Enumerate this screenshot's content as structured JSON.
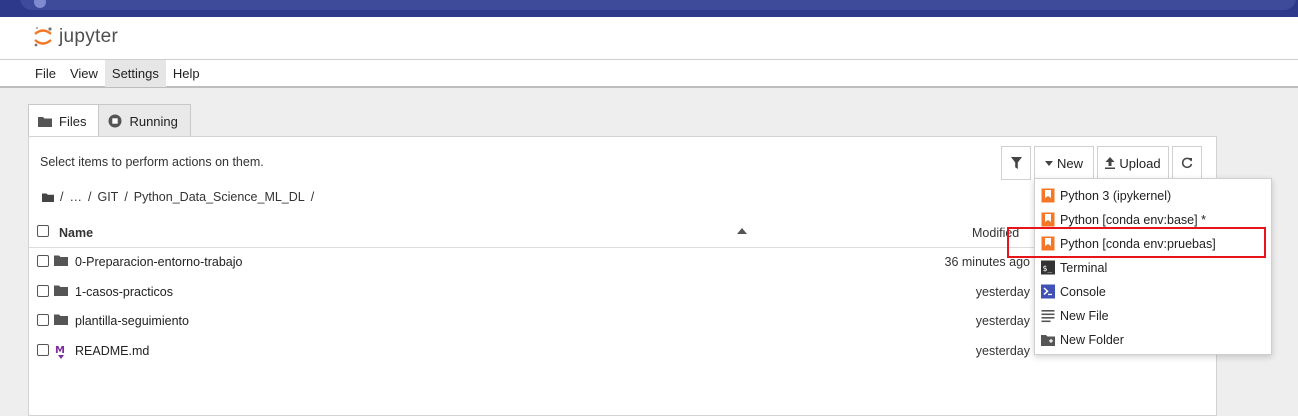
{
  "app": {
    "logo_text": "jupyter"
  },
  "menu": [
    "File",
    "View",
    "Settings",
    "Help"
  ],
  "tabs": [
    {
      "label": "Files",
      "icon": "folder-icon"
    },
    {
      "label": "Running",
      "icon": "stop-circle-icon"
    }
  ],
  "panel": {
    "instructions": "Select items to perform actions on them.",
    "toolbar": {
      "new_label": "New",
      "upload_label": "Upload"
    },
    "breadcrumb": [
      "/",
      "…",
      "/",
      "GIT",
      "/",
      "Python_Data_Science_ML_DL",
      "/"
    ]
  },
  "list": {
    "headers": {
      "name": "Name",
      "modified": "Modified"
    },
    "rows": [
      {
        "name": "0-Preparacion-entorno-trabajo",
        "type": "folder",
        "modified": "36 minutes ago"
      },
      {
        "name": "1-casos-practicos",
        "type": "folder",
        "modified": "yesterday"
      },
      {
        "name": "plantilla-seguimiento",
        "type": "folder",
        "modified": "yesterday"
      },
      {
        "name": "README.md",
        "type": "markdown",
        "modified": "yesterday"
      }
    ]
  },
  "new_menu": {
    "items": [
      {
        "label": "Python 3 (ipykernel)",
        "icon": "notebook-icon"
      },
      {
        "label": "Python [conda env:base] *",
        "icon": "notebook-icon"
      },
      {
        "label": "Python [conda env:pruebas]",
        "icon": "notebook-icon"
      },
      {
        "label": "Terminal",
        "icon": "terminal-icon"
      },
      {
        "label": "Console",
        "icon": "console-icon"
      },
      {
        "label": "New File",
        "icon": "file-icon"
      },
      {
        "label": "New Folder",
        "icon": "new-folder-icon"
      }
    ]
  },
  "colors": {
    "accent_orange": "#f37726",
    "highlight_red": "#e8141c",
    "console_blue": "#3f51b5"
  }
}
